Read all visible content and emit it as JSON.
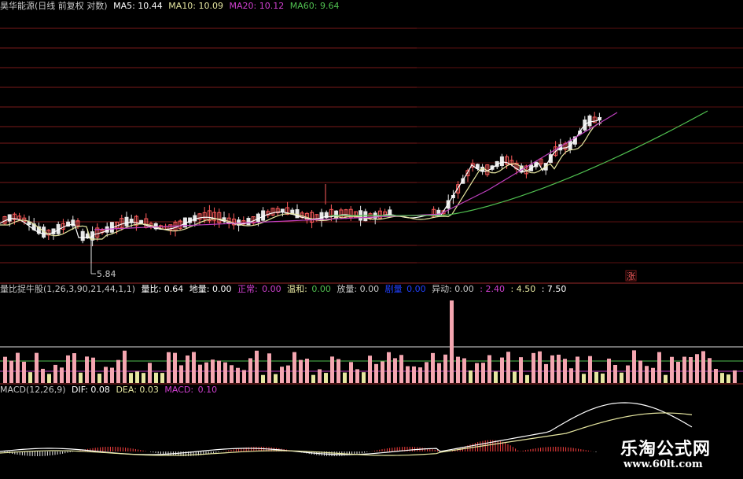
{
  "main_header": {
    "title": "昊华能源(日线 前复权 对数)",
    "ma5": "MA5: 10.44",
    "ma10": "MA10: 10.09",
    "ma20": "MA20: 10.12",
    "ma60": "MA60: 9.64"
  },
  "main_chart": {
    "low_label": "5.84",
    "zhang_label": "涨"
  },
  "volume_header": {
    "title": "量比捉牛股(1,26,3,90,21,44,1,1)",
    "liangbi": "量比: 0.64",
    "diliang": "地量: 0.00",
    "zhengchang_label": "正常:",
    "zhengchang_value": "0.00",
    "wenhe_label": "温和:",
    "wenhe_value": "0.00",
    "fangliang": "放量: 0.00",
    "ruliang_label": "剧量",
    "ruliang_value": "0.00",
    "yidong": "异动: 0.00",
    "v1": ": 2.40",
    "v2": ": 4.50",
    "v3": ": 7.50"
  },
  "macd_header": {
    "title": "MACD(12,26,9)",
    "dif": "DIF: 0.08",
    "dea": "DEA: 0.03",
    "macd_label": "MACD:",
    "macd_value": "0.10"
  },
  "watermark": {
    "name": "乐淘公式网",
    "url": "www.60lt.com"
  },
  "colors": {
    "up": "#ff5c5c",
    "down": "#e8e8e8",
    "ma5": "#ffffff",
    "ma10": "#e6e6a0",
    "ma20": "#c040c0",
    "ma60": "#50c050",
    "volume_bar": "#f4a6b0",
    "volume_dim": "#e6e6a0",
    "grid": "#7a1a1a"
  }
}
